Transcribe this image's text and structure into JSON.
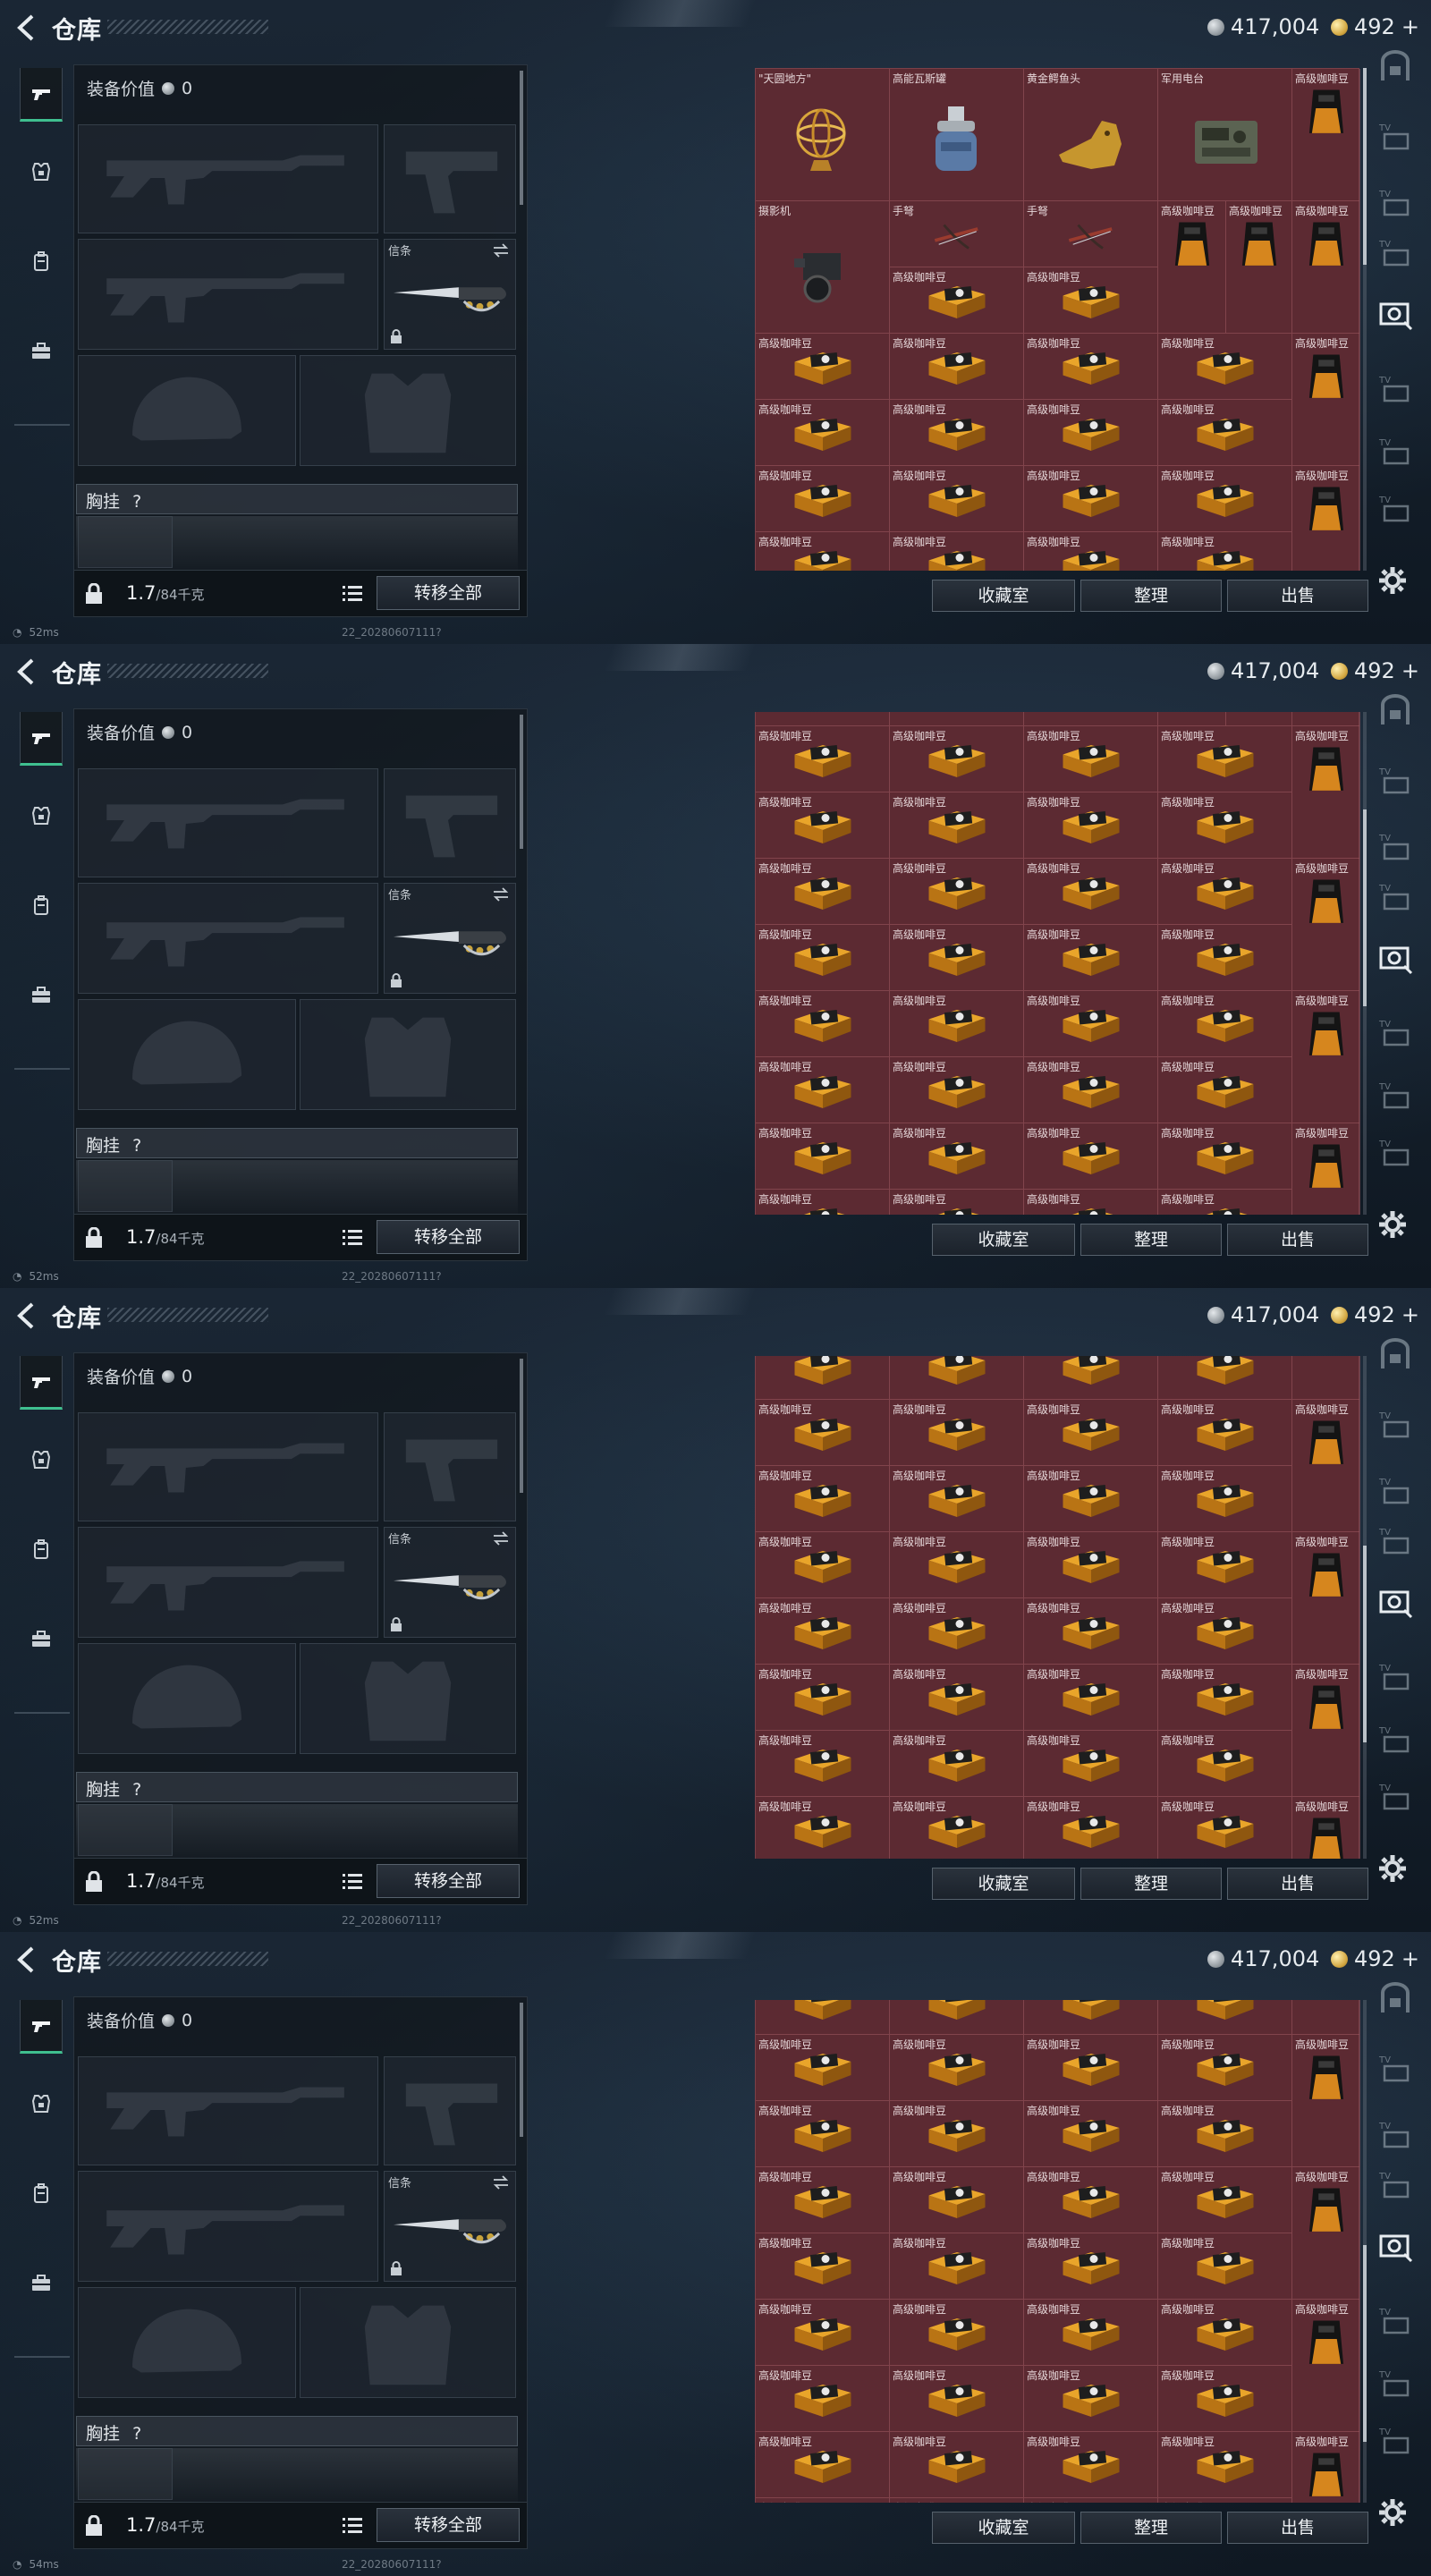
{
  "screens": [
    {
      "scroll": 0.0,
      "ping": "52ms"
    },
    {
      "scroll": 0.32,
      "ping": "52ms"
    },
    {
      "scroll": 0.62,
      "ping": "52ms"
    },
    {
      "scroll": 0.8,
      "ping": "54ms"
    }
  ],
  "header": {
    "title": "仓库",
    "back_icon": "back-arrow-icon",
    "silver": "417,004",
    "gold": "492",
    "gold_plus": "+"
  },
  "left_tabs": [
    "weapon-tab-icon",
    "armor-tab-icon",
    "backpack-tab-icon",
    "case-tab-icon"
  ],
  "equipment": {
    "value_label": "装备价值",
    "value": "0",
    "melee_label": "信条",
    "chest_label": "胸挂",
    "chest_value": "?",
    "weight": "1.7",
    "weight_max": "/84千克",
    "transfer_all": "转移全部"
  },
  "storage": {
    "top_items": [
      {
        "name": "\"天圆地方\"",
        "icon": "armillary-sphere-icon"
      },
      {
        "name": "高能瓦斯罐",
        "icon": "gas-canister-icon"
      },
      {
        "name": "黄金鳄鱼头",
        "icon": "golden-crocodile-head-icon"
      },
      {
        "name": "军用电台",
        "icon": "military-radio-icon"
      },
      {
        "name": "高级咖啡豆",
        "icon": "coffee-bag-icon"
      },
      {
        "name": "摄影机",
        "icon": "video-camera-icon"
      },
      {
        "name": "手弩",
        "icon": "crossbow-icon"
      },
      {
        "name": "手弩",
        "icon": "crossbow-icon"
      }
    ],
    "coffee_bag_name": "高级咖啡豆",
    "coffee_box_name": "高级咖啡豆",
    "buttons": {
      "collection": "收藏室",
      "sort": "整理",
      "sell": "出售"
    }
  },
  "right_rail": [
    "safe-icon",
    "tv-icon",
    "tv-icon",
    "tv-icon",
    "camera-active-icon",
    "tv-icon",
    "tv-icon",
    "tv-icon"
  ],
  "footer": {
    "build": "22_20280607111?"
  }
}
